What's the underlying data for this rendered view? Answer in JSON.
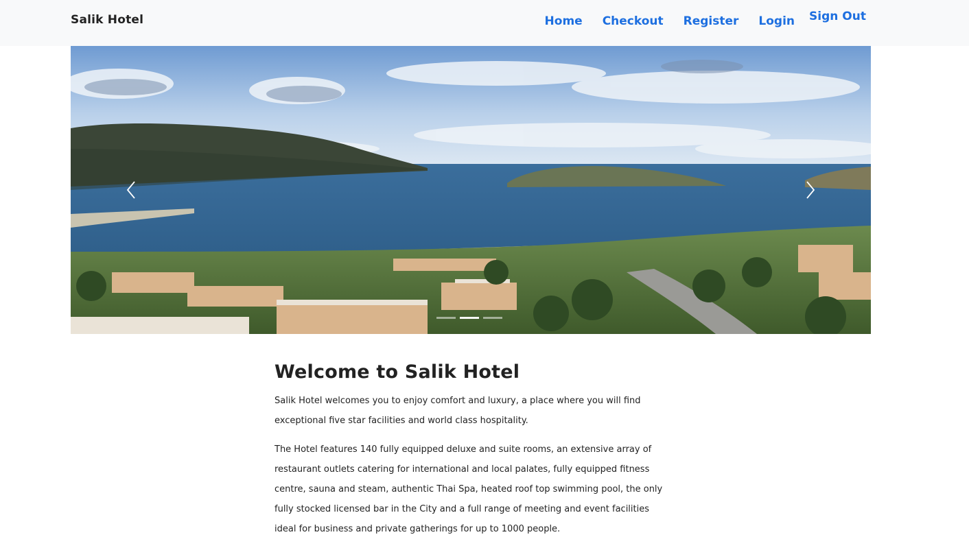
{
  "navbar": {
    "brand": "Salik Hotel",
    "links": [
      "Home",
      "Checkout",
      "Register",
      "Login",
      "Sign Out"
    ]
  },
  "carousel": {
    "image_alt": "Aerial view of a seaside resort with bay, island and hills",
    "slide_count": 3,
    "active_slide": 1,
    "prev_icon": "chevron-left-icon",
    "next_icon": "chevron-right-icon"
  },
  "main": {
    "title": "Welcome to Salik Hotel",
    "paragraphs": [
      "Salik Hotel welcomes you to enjoy comfort and luxury, a place where you will find exceptional five star facilities and world class hospitality.",
      "The Hotel features 140 fully equipped deluxe and suite rooms, an extensive array of restaurant outlets catering for international and local palates, fully equipped fitness centre, sauna and steam, authentic Thai Spa, heated roof top swimming pool, the only fully stocked licensed bar in the City and a full range of meeting and event facilities ideal for business and private gatherings for up to 1000 people."
    ]
  },
  "colors": {
    "link": "#1d6fe0",
    "navbar_bg": "#f8f9fa",
    "text": "#222222"
  }
}
